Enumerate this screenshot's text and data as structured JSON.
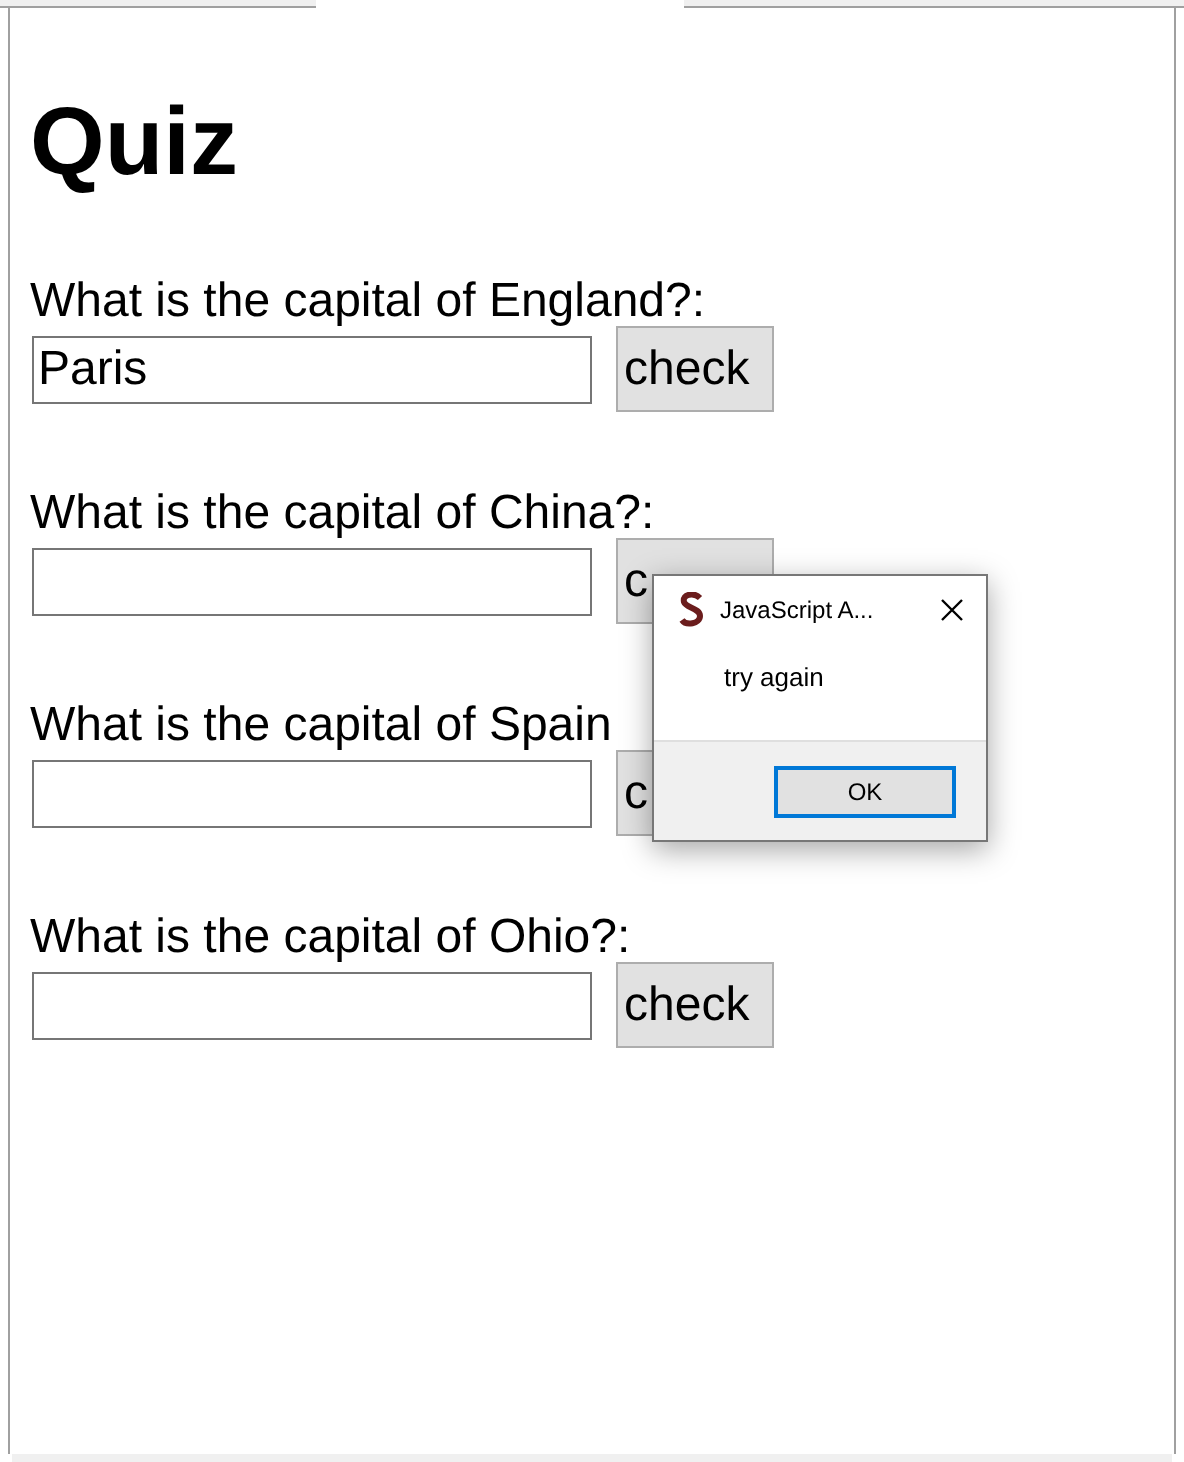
{
  "heading": "Quiz",
  "questions": [
    {
      "label": "What is the capital of England?:",
      "value": "Paris",
      "button": "check"
    },
    {
      "label": "What is the capital of China?:",
      "button": "c"
    },
    {
      "label": "What is the capital of Spain",
      "button": "c"
    },
    {
      "label": "What is the capital of Ohio?:",
      "button": "check"
    }
  ],
  "dialog": {
    "title": "JavaScript A...",
    "message": "try again",
    "button": "OK"
  }
}
